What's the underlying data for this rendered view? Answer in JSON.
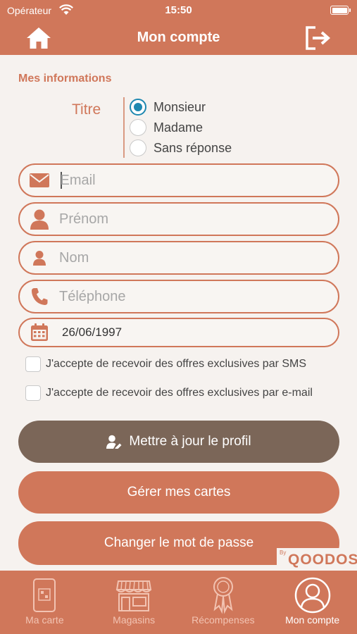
{
  "status_bar": {
    "carrier": "Opérateur",
    "time": "15:50"
  },
  "navbar": {
    "title": "Mon compte"
  },
  "section_title": "Mes informations",
  "titre": {
    "label": "Titre",
    "options": [
      {
        "label": "Monsieur",
        "checked": true
      },
      {
        "label": "Madame",
        "checked": false
      },
      {
        "label": "Sans réponse",
        "checked": false
      }
    ]
  },
  "fields": {
    "email": {
      "value": "",
      "placeholder": "Email"
    },
    "prenom": {
      "value": "",
      "placeholder": "Prénom"
    },
    "nom": {
      "value": "",
      "placeholder": "Nom"
    },
    "telephone": {
      "value": "",
      "placeholder": "Téléphone"
    },
    "birthdate": {
      "value": "26/06/1997"
    }
  },
  "consents": {
    "sms": {
      "label": "J'accepte de recevoir des offres exclusives par SMS",
      "checked": false
    },
    "email": {
      "label": "J'accepte de recevoir des offres exclusives par e-mail",
      "checked": false
    }
  },
  "buttons": {
    "update_profile": "Mettre à jour le profil",
    "manage_cards": "Gérer mes cartes",
    "change_password": "Changer le mot de passe"
  },
  "brand": {
    "by": "By",
    "name": "QOODOS"
  },
  "tabs": [
    {
      "label": "Ma carte",
      "icon": "card-icon",
      "active": false
    },
    {
      "label": "Magasins",
      "icon": "store-icon",
      "active": false
    },
    {
      "label": "Récompenses",
      "icon": "award-icon",
      "active": false
    },
    {
      "label": "Mon compte",
      "icon": "user-circle-icon",
      "active": true
    }
  ],
  "colors": {
    "primary": "#d0775a",
    "update_button": "#7b6658",
    "radio_accent": "#1e88b0",
    "background": "#f6f2ef"
  }
}
